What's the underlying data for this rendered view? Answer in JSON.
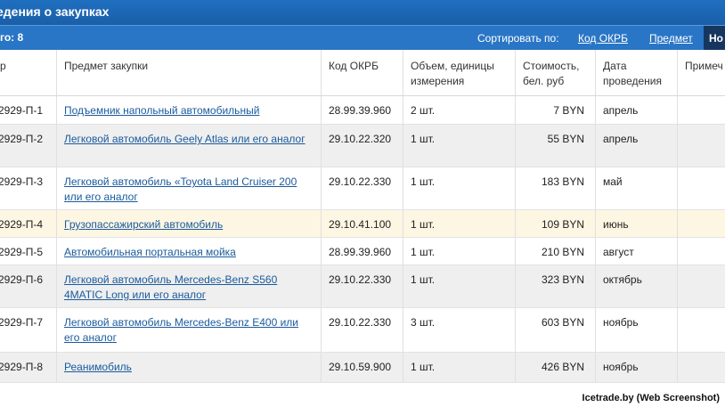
{
  "title": "едения о закупках",
  "toolbar": {
    "total": "го: 8",
    "sort_label": "Сортировать по:",
    "sort_okrb": "Код ОКРБ",
    "sort_subject": "Предмет",
    "sort_active": "Но"
  },
  "columns": [
    "р",
    "Предмет закупки",
    "Код ОКРБ",
    "Объем, единицы измерения",
    "Стоимость, бел. руб",
    "Дата проведения",
    "Примеч"
  ],
  "rows": [
    {
      "num": "2929-П-1",
      "subject": "Подъемник напольный автомобильный",
      "okrb": "28.99.39.960",
      "volume": "2 шт.",
      "cost": "7 BYN",
      "date": "апрель"
    },
    {
      "num": "2929-П-2",
      "subject": "Легковой автомобиль Geely Atlas или его аналог",
      "okrb": "29.10.22.320",
      "volume": "1 шт.",
      "cost": "55 BYN",
      "date": "апрель"
    },
    {
      "num": "2929-П-3",
      "subject": "Легковой автомобиль «Toyota Land Cruiser 200 или его аналог",
      "okrb": "29.10.22.330",
      "volume": "1 шт.",
      "cost": "183 BYN",
      "date": "май"
    },
    {
      "num": "2929-П-4",
      "subject": "Грузопассажирский автомобиль",
      "okrb": "29.10.41.100",
      "volume": "1 шт.",
      "cost": "109 BYN",
      "date": "июнь"
    },
    {
      "num": "2929-П-5",
      "subject": "Автомобильная портальная мойка",
      "okrb": "28.99.39.960",
      "volume": "1 шт.",
      "cost": "210 BYN",
      "date": "август"
    },
    {
      "num": "2929-П-6",
      "subject": "Легковой автомобиль Mercedes-Benz S560 4MATIC Long или его аналог",
      "okrb": "29.10.22.330",
      "volume": "1 шт.",
      "cost": "323 BYN",
      "date": "октябрь"
    },
    {
      "num": "2929-П-7",
      "subject": "Легковой автомобиль Mercedes-Benz E400 или его аналог",
      "okrb": "29.10.22.330",
      "volume": "3 шт.",
      "cost": "603 BYN",
      "date": "ноябрь"
    },
    {
      "num": "2929-П-8",
      "subject": "Реанимобиль",
      "okrb": "29.10.59.900",
      "volume": "1 шт.",
      "cost": "426 BYN",
      "date": "ноябрь"
    }
  ],
  "watermark": "Icetrade.by (Web Screenshot)"
}
